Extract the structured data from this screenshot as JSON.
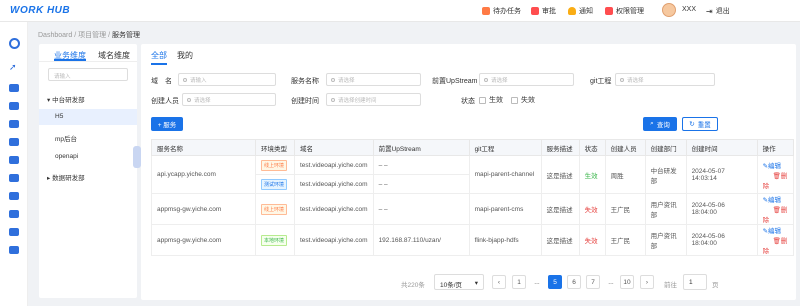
{
  "app": {
    "logo": "WORK HUB"
  },
  "header": {
    "nav": [
      {
        "label": "待办任务",
        "icon": "todo-icon",
        "color": "#ff7a45"
      },
      {
        "label": "审批",
        "icon": "approval-icon",
        "color": "#ff4d4f"
      },
      {
        "label": "通知",
        "icon": "bell-icon",
        "color": "#faad14"
      },
      {
        "label": "权限管理",
        "icon": "permission-icon",
        "color": "#ff4d4f"
      }
    ],
    "user": "XXX",
    "logout": "退出"
  },
  "breadcrumb": {
    "items": [
      "Dashboard",
      "项目管理"
    ],
    "current": "服务管理",
    "sep": "/"
  },
  "tree": {
    "tabs": [
      "业务维度",
      "域名维度"
    ],
    "search_placeholder": "请输入",
    "nodes": [
      "中台研发部",
      "H5",
      "mp后台",
      "openapi",
      "数据研发部"
    ]
  },
  "main": {
    "tabs": [
      "全部",
      "我的"
    ],
    "filters": {
      "domain_label": "域　名",
      "domain_ph": "请输入",
      "service_label": "服务名称",
      "service_ph": "请选择",
      "upstream_label": "前置UpStream",
      "upstream_ph": "请选择",
      "git_label": "git工程",
      "git_ph": "请选择",
      "creator_label": "创建人员",
      "creator_ph": "请选择",
      "time_label": "创建时间",
      "time_ph": "请选择创建时间",
      "status_label": "状态",
      "status_ok": "生效",
      "status_bad": "失效"
    },
    "add_button": "+ 服务",
    "query_button": "查询",
    "reset_button": "重置"
  },
  "table": {
    "headers": [
      "服务名称",
      "环境类型",
      "域名",
      "前置UpStream",
      "git工程",
      "服务描述",
      "状态",
      "创建人员",
      "创建部门",
      "创建时间",
      "操作"
    ],
    "rows": [
      {
        "name": "api.ycapp.yiche.com",
        "env1": "线上环境",
        "env2": "测试环境",
        "domain1": "test.videoapi.yiche.com",
        "domain2": "test.videoapi.yiche.com",
        "upstream1": "– –",
        "upstream2": "– –",
        "git": "mapi-parent-channel",
        "desc": "这是描述",
        "status": "生效",
        "creator": "周胜",
        "dept": "中台研发部",
        "time": "2024-05-07 14:03:14",
        "edit": "编辑",
        "del": "删除"
      },
      {
        "name": "appmsg-gw.yiche.com",
        "env1": "线上环境",
        "domain1": "test.videoapi.yiche.com",
        "upstream1": "– –",
        "git": "mapi-parent-cms",
        "desc": "这是描述",
        "status": "失效",
        "creator": "王广民",
        "dept": "用户资讯部",
        "time": "2024-05-06 18:04:00",
        "edit": "编辑",
        "del": "删除"
      },
      {
        "name": "appmsg-gw.yiche.com",
        "env1": "本地环境",
        "domain1": "test.videoapi.yiche.com",
        "upstream1": "192.168.87.110/uzan/",
        "git": "flink-bjapp-hdfs",
        "desc": "这是描述",
        "status": "失效",
        "creator": "王广民",
        "dept": "用户资讯部",
        "time": "2024-05-06 18:04:00",
        "edit": "编辑",
        "del": "删除"
      }
    ]
  },
  "pagination": {
    "total": "共220条",
    "page_size": "10条/页",
    "pages": [
      "1",
      "...",
      "5",
      "6",
      "7",
      "...",
      "10"
    ],
    "current_page": "5",
    "goto_label": "前往",
    "goto_value": "1",
    "goto_suffix": "页"
  },
  "colors": {
    "primary": "#1a73e8",
    "ok": "#39b54a",
    "bad": "#e64340",
    "tag_online": "#ff7a45",
    "tag_test": "#1a73e8",
    "tag_local": "#39b54a"
  }
}
